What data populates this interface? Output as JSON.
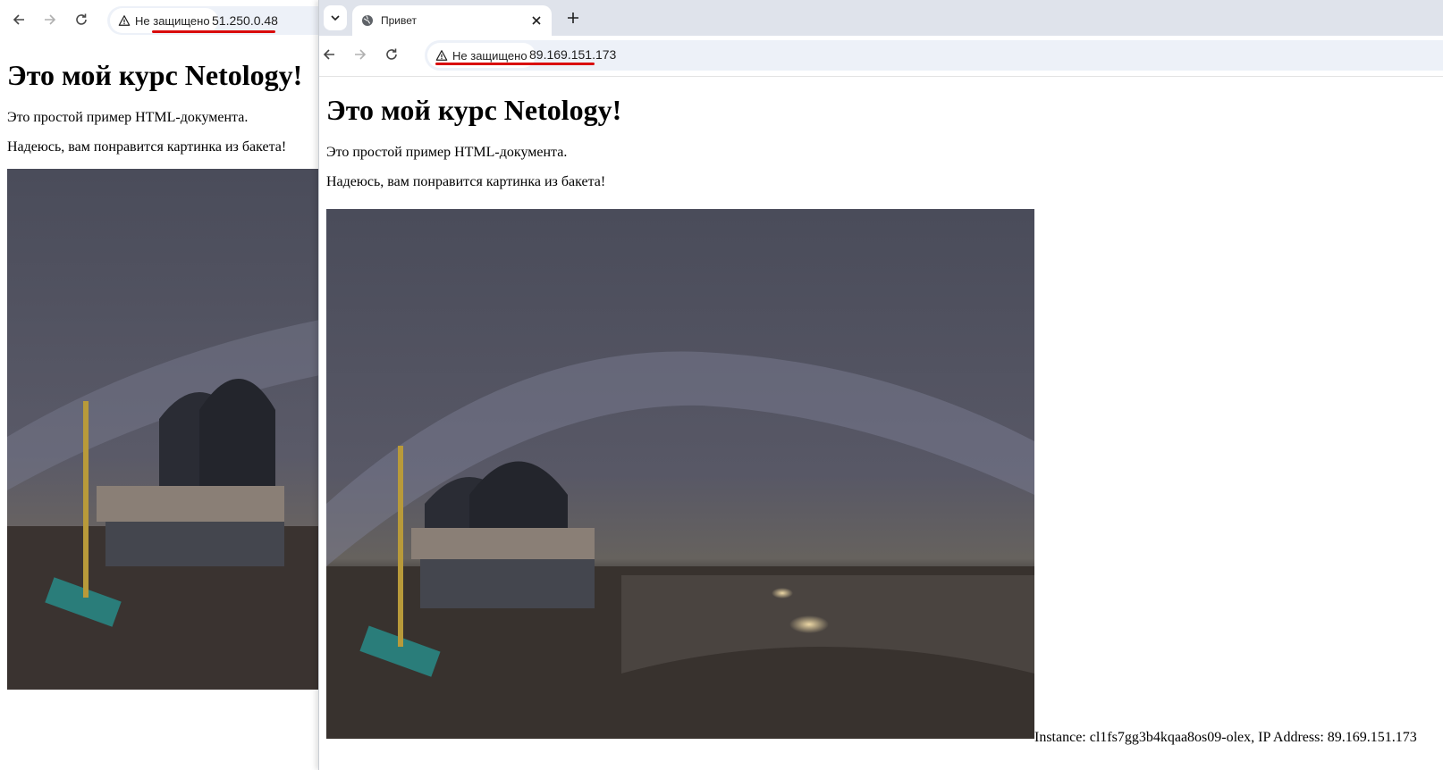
{
  "back_window": {
    "security_label": "Не защищено",
    "url": "51.250.0.48",
    "page": {
      "heading": "Это мой курс Netology!",
      "paragraph_1": "Это простой пример HTML-документа.",
      "paragraph_2": "Надеюсь, вам понравится картинка из бакета!"
    }
  },
  "front_window": {
    "tab_title": "Привет",
    "security_label": "Не защищено",
    "url": "89.169.151.173",
    "page": {
      "heading": "Это мой курс Netology!",
      "paragraph_1": "Это простой пример HTML-документа.",
      "paragraph_2": "Надеюсь, вам понравится картинка из бакета!",
      "instance_info": "Instance: cl1fs7gg3b4kqaa8os09-olex, IP Address: 89.169.151.173"
    }
  },
  "colors": {
    "annotation_underline": "#d90b0b",
    "tabstrip_bg": "#dfe3eb",
    "omnibox_bg": "#edf1f8"
  },
  "icons": [
    "back-arrow-icon",
    "forward-arrow-icon",
    "reload-icon",
    "warning-triangle-icon",
    "chevron-down-icon",
    "globe-icon",
    "close-icon",
    "plus-icon"
  ]
}
